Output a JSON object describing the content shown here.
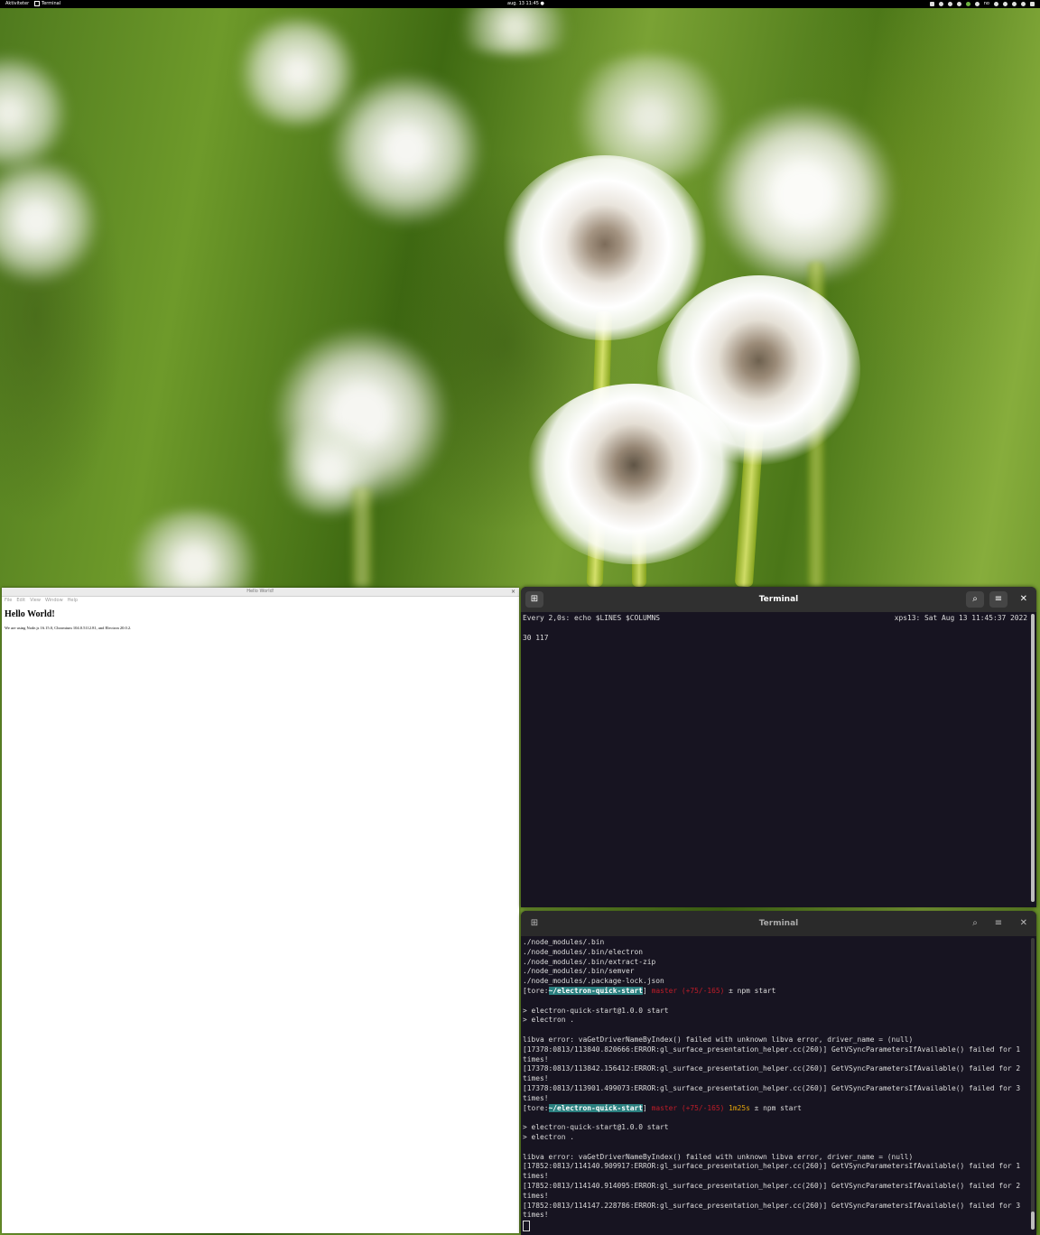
{
  "topbar": {
    "activities": "Aktiviteter",
    "app_name": "Terminal",
    "clock": "aug. 13 11:45",
    "tray_label": "no"
  },
  "electron": {
    "window_title": "Hello World!",
    "close_glyph": "×",
    "menu": [
      "File",
      "Edit",
      "View",
      "Window",
      "Help"
    ],
    "heading": "Hello World!",
    "body": "We are using Node.js 16.15.0, Chromium 104.0.5112.81, and Electron 20.0.2."
  },
  "terminal_top": {
    "title": "Terminal",
    "new_tab_icon": "new-tab-icon",
    "search_icon": "search-icon",
    "menu_icon": "hamburger-menu-icon",
    "close_glyph": "✕",
    "header_left": "Every 2,0s: echo $LINES $COLUMNS",
    "header_right": "xps13: Sat Aug 13 11:45:37 2022",
    "output": "30 117"
  },
  "terminal_bottom": {
    "title": "Terminal",
    "close_glyph": "✕",
    "lines_a": [
      "./node_modules/.bin",
      "./node_modules/.bin/electron",
      "./node_modules/.bin/extract-zip",
      "./node_modules/.bin/semver",
      "./node_modules/.package-lock.json"
    ],
    "prompt1": {
      "user": "[tore:",
      "dir": "~/electron-quick-start",
      "close": "]",
      "branch": "master",
      "diff": "(+75/-165)",
      "time": "",
      "cmd": "± npm start"
    },
    "lines_b": [
      "",
      "> electron-quick-start@1.0.0 start",
      "> electron .",
      "",
      "libva error: vaGetDriverNameByIndex() failed with unknown libva error, driver_name = (null)",
      "[17378:0813/113840.820666:ERROR:gl_surface_presentation_helper.cc(260)] GetVSyncParametersIfAvailable() failed for 1",
      "times!",
      "[17378:0813/113842.156412:ERROR:gl_surface_presentation_helper.cc(260)] GetVSyncParametersIfAvailable() failed for 2",
      "times!",
      "[17378:0813/113901.499073:ERROR:gl_surface_presentation_helper.cc(260)] GetVSyncParametersIfAvailable() failed for 3",
      "times!"
    ],
    "prompt2": {
      "user": "[tore:",
      "dir": "~/electron-quick-start",
      "close": "]",
      "branch": "master",
      "diff": "(+75/-165)",
      "time": "1m25s",
      "cmd": "± npm start"
    },
    "lines_c": [
      "",
      "> electron-quick-start@1.0.0 start",
      "> electron .",
      "",
      "libva error: vaGetDriverNameByIndex() failed with unknown libva error, driver_name = (null)",
      "[17852:0813/114140.909917:ERROR:gl_surface_presentation_helper.cc(260)] GetVSyncParametersIfAvailable() failed for 1",
      "times!",
      "[17852:0813/114140.914095:ERROR:gl_surface_presentation_helper.cc(260)] GetVSyncParametersIfAvailable() failed for 2",
      "times!",
      "[17852:0813/114147.228786:ERROR:gl_surface_presentation_helper.cc(260)] GetVSyncParametersIfAvailable() failed for 3",
      "times!"
    ]
  },
  "colors": {
    "terminal_bg": "#171421",
    "header_bg": "#303030",
    "prompt_dir_bg": "#2a7f7f",
    "branch_red": "#c01c28",
    "time_yellow": "#e5a50a"
  }
}
